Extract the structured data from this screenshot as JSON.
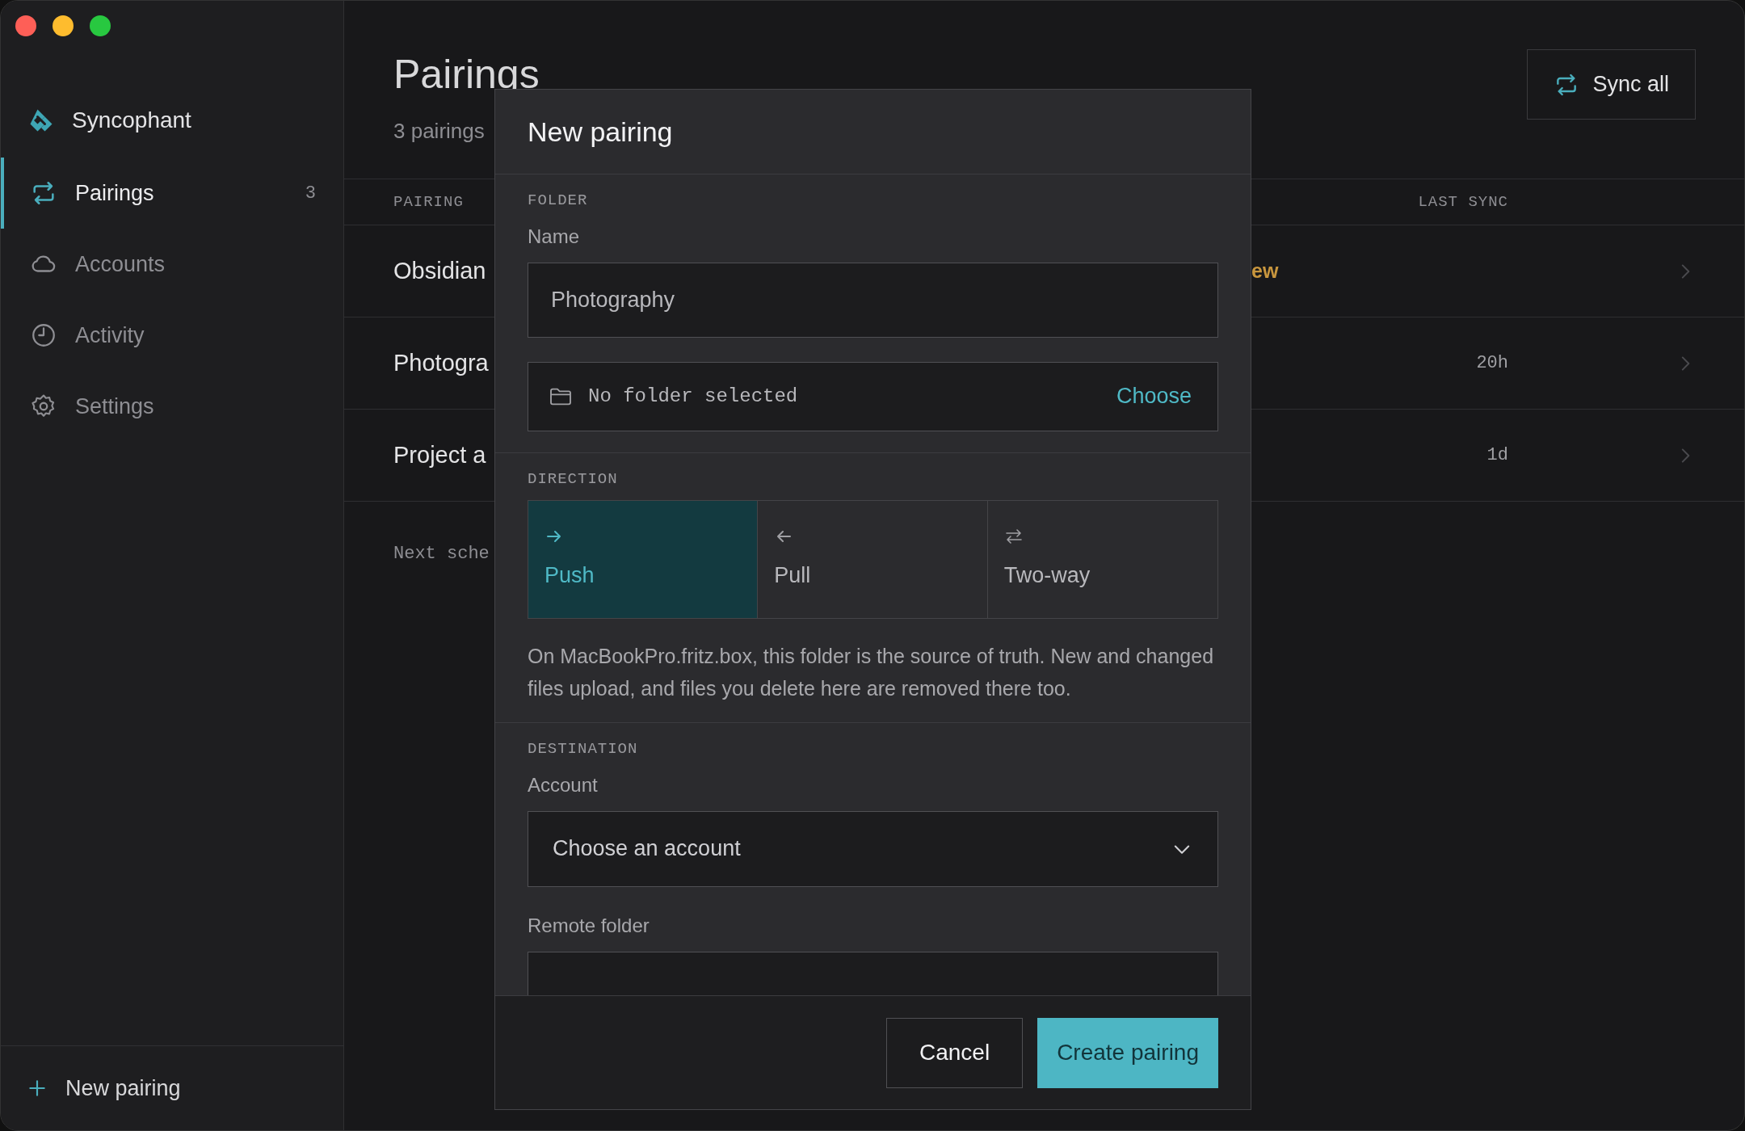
{
  "sidebar": {
    "brand": "Syncophant",
    "items": [
      {
        "label": "Pairings",
        "count": "3",
        "selected": true
      },
      {
        "label": "Accounts",
        "selected": false
      },
      {
        "label": "Activity",
        "selected": false
      },
      {
        "label": "Settings",
        "selected": false
      }
    ],
    "new_pairing": "New pairing"
  },
  "main": {
    "title": "Pairings",
    "subtitle": "3 pairings",
    "sync_button": "Sync all",
    "table": {
      "columns": [
        "PAIRING",
        "LAST SYNC"
      ],
      "rows": [
        {
          "name": "Obsidian",
          "status": "ew"
        },
        {
          "name": "Photogra",
          "last_sync": "20h"
        },
        {
          "name": "Project a",
          "last_sync": "1d"
        }
      ]
    },
    "footer_note": "Next sche"
  },
  "dialog": {
    "title": "New pairing",
    "folder": {
      "section": "FOLDER",
      "name_label": "Name",
      "name_value": "Photography",
      "picker_text": "No folder selected",
      "picker_action": "Choose"
    },
    "direction": {
      "section": "DIRECTION",
      "options": [
        {
          "label": "Push",
          "selected": true
        },
        {
          "label": "Pull",
          "selected": false
        },
        {
          "label": "Two-way",
          "selected": false
        }
      ],
      "description": "On MacBookPro.fritz.box, this folder is the source of truth. New and changed files upload, and files you delete here are removed there too."
    },
    "destination": {
      "section": "DESTINATION",
      "account_label": "Account",
      "account_value": "Choose an account",
      "remote_label": "Remote folder"
    },
    "buttons": {
      "cancel": "Cancel",
      "create": "Create pairing"
    }
  }
}
